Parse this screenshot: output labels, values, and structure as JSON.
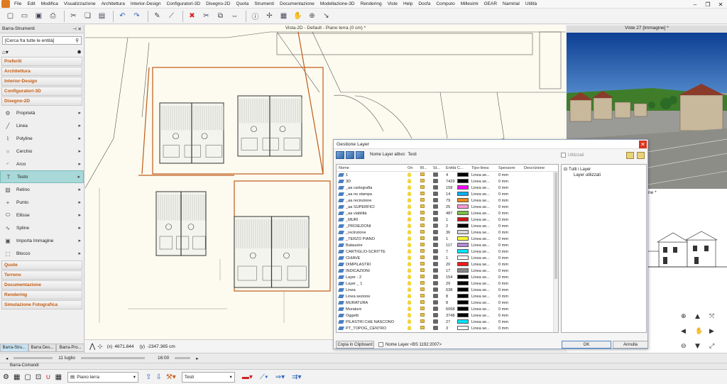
{
  "menu": [
    "File",
    "Edit",
    "Modifica",
    "Visualizzazione",
    "Architettura",
    "Interior-Design",
    "Configuratori-3D",
    "Disegno-2D",
    "Quota",
    "Strumenti",
    "Documentazione",
    "Modellazione-3D",
    "Rendering",
    "Viste",
    "Help",
    "Docfa",
    "Computo",
    "Millesimi",
    "GEAR",
    "Namirial",
    "Utilità"
  ],
  "left_panel": {
    "title": "Barra-Strumenti",
    "search_placeholder": "[Cerca fra tutte le entità]",
    "categories_top": [
      "Preferiti",
      "Architettura",
      "Interior-Design",
      "Configuratori-3D",
      "Disegno-2D"
    ],
    "tools": [
      "Proprietà",
      "Linea",
      "Polyline",
      "Cerchio",
      "Arco",
      "Testo",
      "Retino",
      "Punto",
      "Ellisse",
      "Spline",
      "Importa Immagine",
      "Blocco"
    ],
    "active_tool": "Testo",
    "categories_bottom": [
      "Quote",
      "Terreno",
      "Documentazione",
      "Rendering",
      "Simulazione Fotografica"
    ],
    "tabs": [
      "Barra-Stru...",
      "Barra Des...",
      "Barra-Pro..."
    ]
  },
  "view2d": {
    "title": "Vista-2D - Default - Piano terra (0 cm) *"
  },
  "view3d": {
    "title": "Viste 27 [Immagine] *"
  },
  "viewb": {
    "title_fragment": "ione *"
  },
  "coords": {
    "x_label": "(x)",
    "x": "4671.844",
    "y_label": "(y)",
    "y": "-2347.365 cm"
  },
  "status": {
    "date": "11 luglio",
    "time": "16:00"
  },
  "command_bar": "Barra-Comandi",
  "bottom": {
    "floor": "Piano terra",
    "layer": "Testi"
  },
  "dialog": {
    "title": "Gestione Layer",
    "active_layer_label": "Nome Layer attivo:",
    "active_layer": "Testi",
    "used_label": "Utilizzati",
    "columns": [
      "Nome",
      "On",
      "Bl...",
      "St...",
      "Entità",
      "C...",
      "Tipo-linea",
      "Spessore",
      "Descrizione"
    ],
    "rows": [
      {
        "name": "1",
        "entities": "4",
        "color": "#000000",
        "line": "Linea se...",
        "thick": "0 mm"
      },
      {
        "name": "3D",
        "entities": "7429",
        "color": "#000000",
        "line": "Linea se...",
        "thick": "0 mm"
      },
      {
        "name": "_aa cartografia",
        "entities": "158",
        "color": "#ff00ff",
        "line": "Linea se...",
        "thick": "0 mm"
      },
      {
        "name": "_aa no stampa",
        "entities": "14",
        "color": "#00b0f0",
        "line": "Linea se...",
        "thick": "0 mm"
      },
      {
        "name": "_aa recinzione",
        "entities": "79",
        "color": "#f08a1a",
        "line": "Linea se...",
        "thick": "0 mm"
      },
      {
        "name": "_aa SUPERFICI",
        "entities": "25",
        "color": "#ff9ad5",
        "line": "Linea se...",
        "thick": "0 mm"
      },
      {
        "name": "_aa viabilità",
        "entities": "487",
        "color": "#7ac143",
        "line": "Linea se...",
        "thick": "0 mm"
      },
      {
        "name": "_MURI",
        "entities": "1",
        "color": "#d01818",
        "line": "Linea se...",
        "thick": "0 mm"
      },
      {
        "name": "_PROIEZIONI",
        "entities": "2",
        "color": "#000000",
        "line": "Linea se...",
        "thick": "0 mm"
      },
      {
        "name": "_recinzione",
        "entities": "36",
        "color": "#d8d8d8",
        "line": "Linea se...",
        "thick": "0 mm"
      },
      {
        "name": "_TERZO PIANO",
        "entities": "1",
        "color": "#ffff33",
        "line": "Linea se...",
        "thick": "0 mm"
      },
      {
        "name": "Balaustre",
        "entities": "117",
        "color": "#b58ad8",
        "line": "Linea se...",
        "thick": "0 mm"
      },
      {
        "name": "CARTIGLIO-SCRITTE",
        "entities": "7",
        "color": "#00e5ff",
        "line": "Linea se...",
        "thick": "0 mm"
      },
      {
        "name": "CHIAVE",
        "entities": "1",
        "color": "#ffffff",
        "line": "Linea se...",
        "thick": "0 mm"
      },
      {
        "name": "DIMPILASTRI",
        "entities": "20",
        "color": "#ff1a1a",
        "line": "Linea se...",
        "thick": "0 mm"
      },
      {
        "name": "INDICAZIONI",
        "entities": "17",
        "color": "#8a8a8a",
        "line": "Linea se...",
        "thick": "0 mm"
      },
      {
        "name": "Layer - 2",
        "entities": "154",
        "color": "#000000",
        "line": "Linea se...",
        "thick": "0 mm"
      },
      {
        "name": "Layer _ 1",
        "entities": "29",
        "color": "#000000",
        "line": "Linea se...",
        "thick": "0 mm"
      },
      {
        "name": "Linea",
        "entities": "638",
        "color": "#000000",
        "line": "Linea se...",
        "thick": "0 mm"
      },
      {
        "name": "Linea sezione",
        "entities": "8",
        "color": "#000000",
        "line": "Linea se...",
        "thick": "0 mm"
      },
      {
        "name": "MURATURA",
        "entities": "8",
        "color": "#000000",
        "line": "Linea se...",
        "thick": "0 mm"
      },
      {
        "name": "Murature",
        "entities": "6068",
        "color": "#000000",
        "line": "Linea se...",
        "thick": "0 mm"
      },
      {
        "name": "Oggetti",
        "entities": "3748",
        "color": "#000000",
        "line": "Linea se...",
        "thick": "0 mm"
      },
      {
        "name": "PILASTRI CHE NASCONO",
        "entities": "27",
        "color": "#00e5ff",
        "line": "Linea se...",
        "thick": "0 mm"
      },
      {
        "name": "PT_TOPOG_CENTRO",
        "entities": "3",
        "color": "#ffffff",
        "line": "Linea se...",
        "thick": "0 mm"
      }
    ],
    "tree_root": "Tutti i Layer",
    "tree_child": "Layer utilizzati",
    "clipboard_btn": "Copia in Clipboard",
    "name_layer_label": "Nome Layer <BS 1192:2007>",
    "ok": "OK",
    "cancel": "Annulla"
  }
}
